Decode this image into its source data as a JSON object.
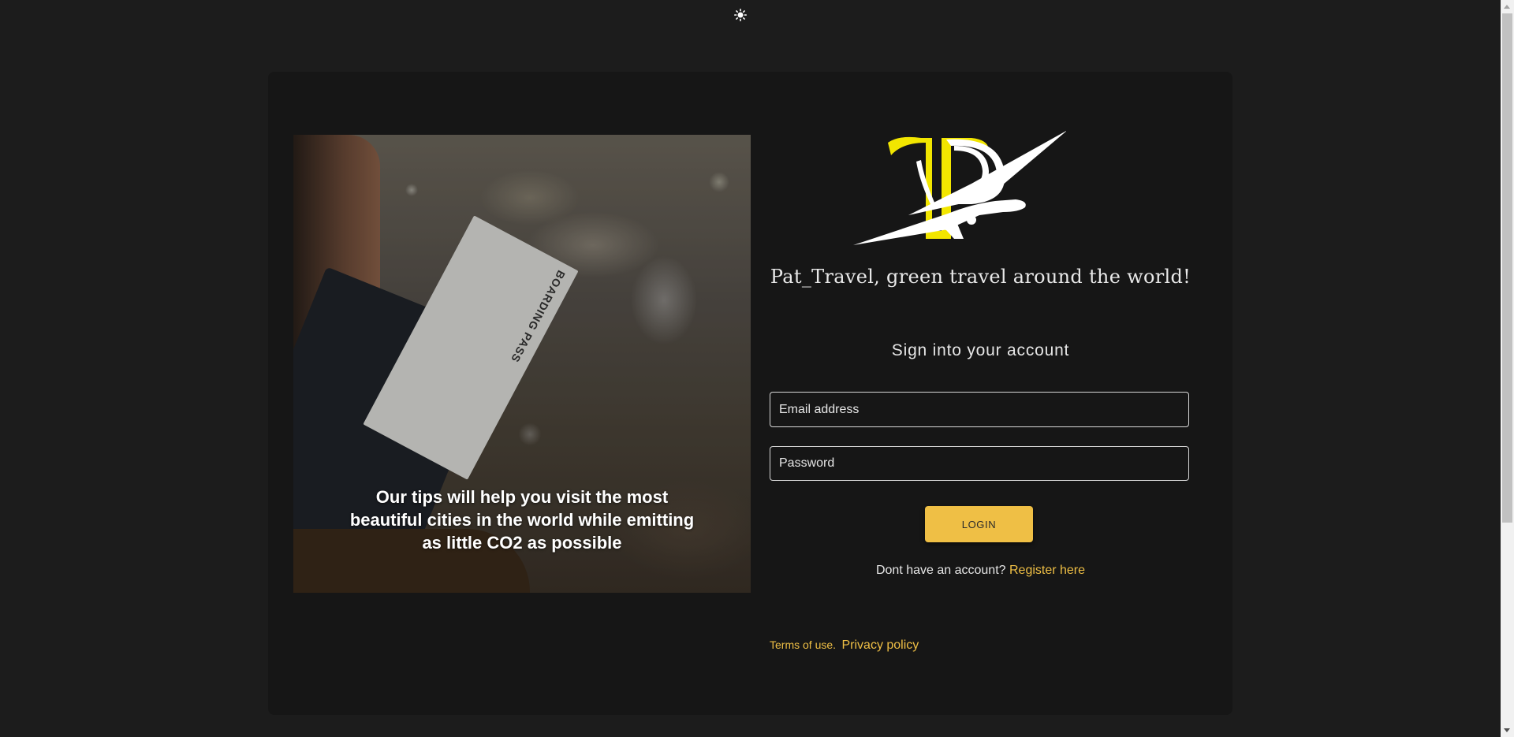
{
  "theme_toggle": {
    "icon": "sun-icon"
  },
  "hero": {
    "caption": "Our tips will help you visit the most beautiful cities in the world while emitting as little CO2 as possible",
    "boarding_label": "BOARDING PASS"
  },
  "brand": {
    "logo_letters": "TP",
    "tagline": "Pat_Travel, green travel around the world!",
    "accent_color": "#efbf45",
    "logo_yellow": "#f2e600"
  },
  "form": {
    "title": "Sign into your account",
    "email_placeholder": "Email address",
    "password_placeholder": "Password",
    "login_label": "LOGIN",
    "register_prompt": "Dont have an account?",
    "register_link": "Register here"
  },
  "footer": {
    "terms": "Terms of use.",
    "privacy": "Privacy policy"
  },
  "colors": {
    "page_bg": "#1c1c1c",
    "card_bg": "#161616",
    "text": "#e6e6e6"
  }
}
